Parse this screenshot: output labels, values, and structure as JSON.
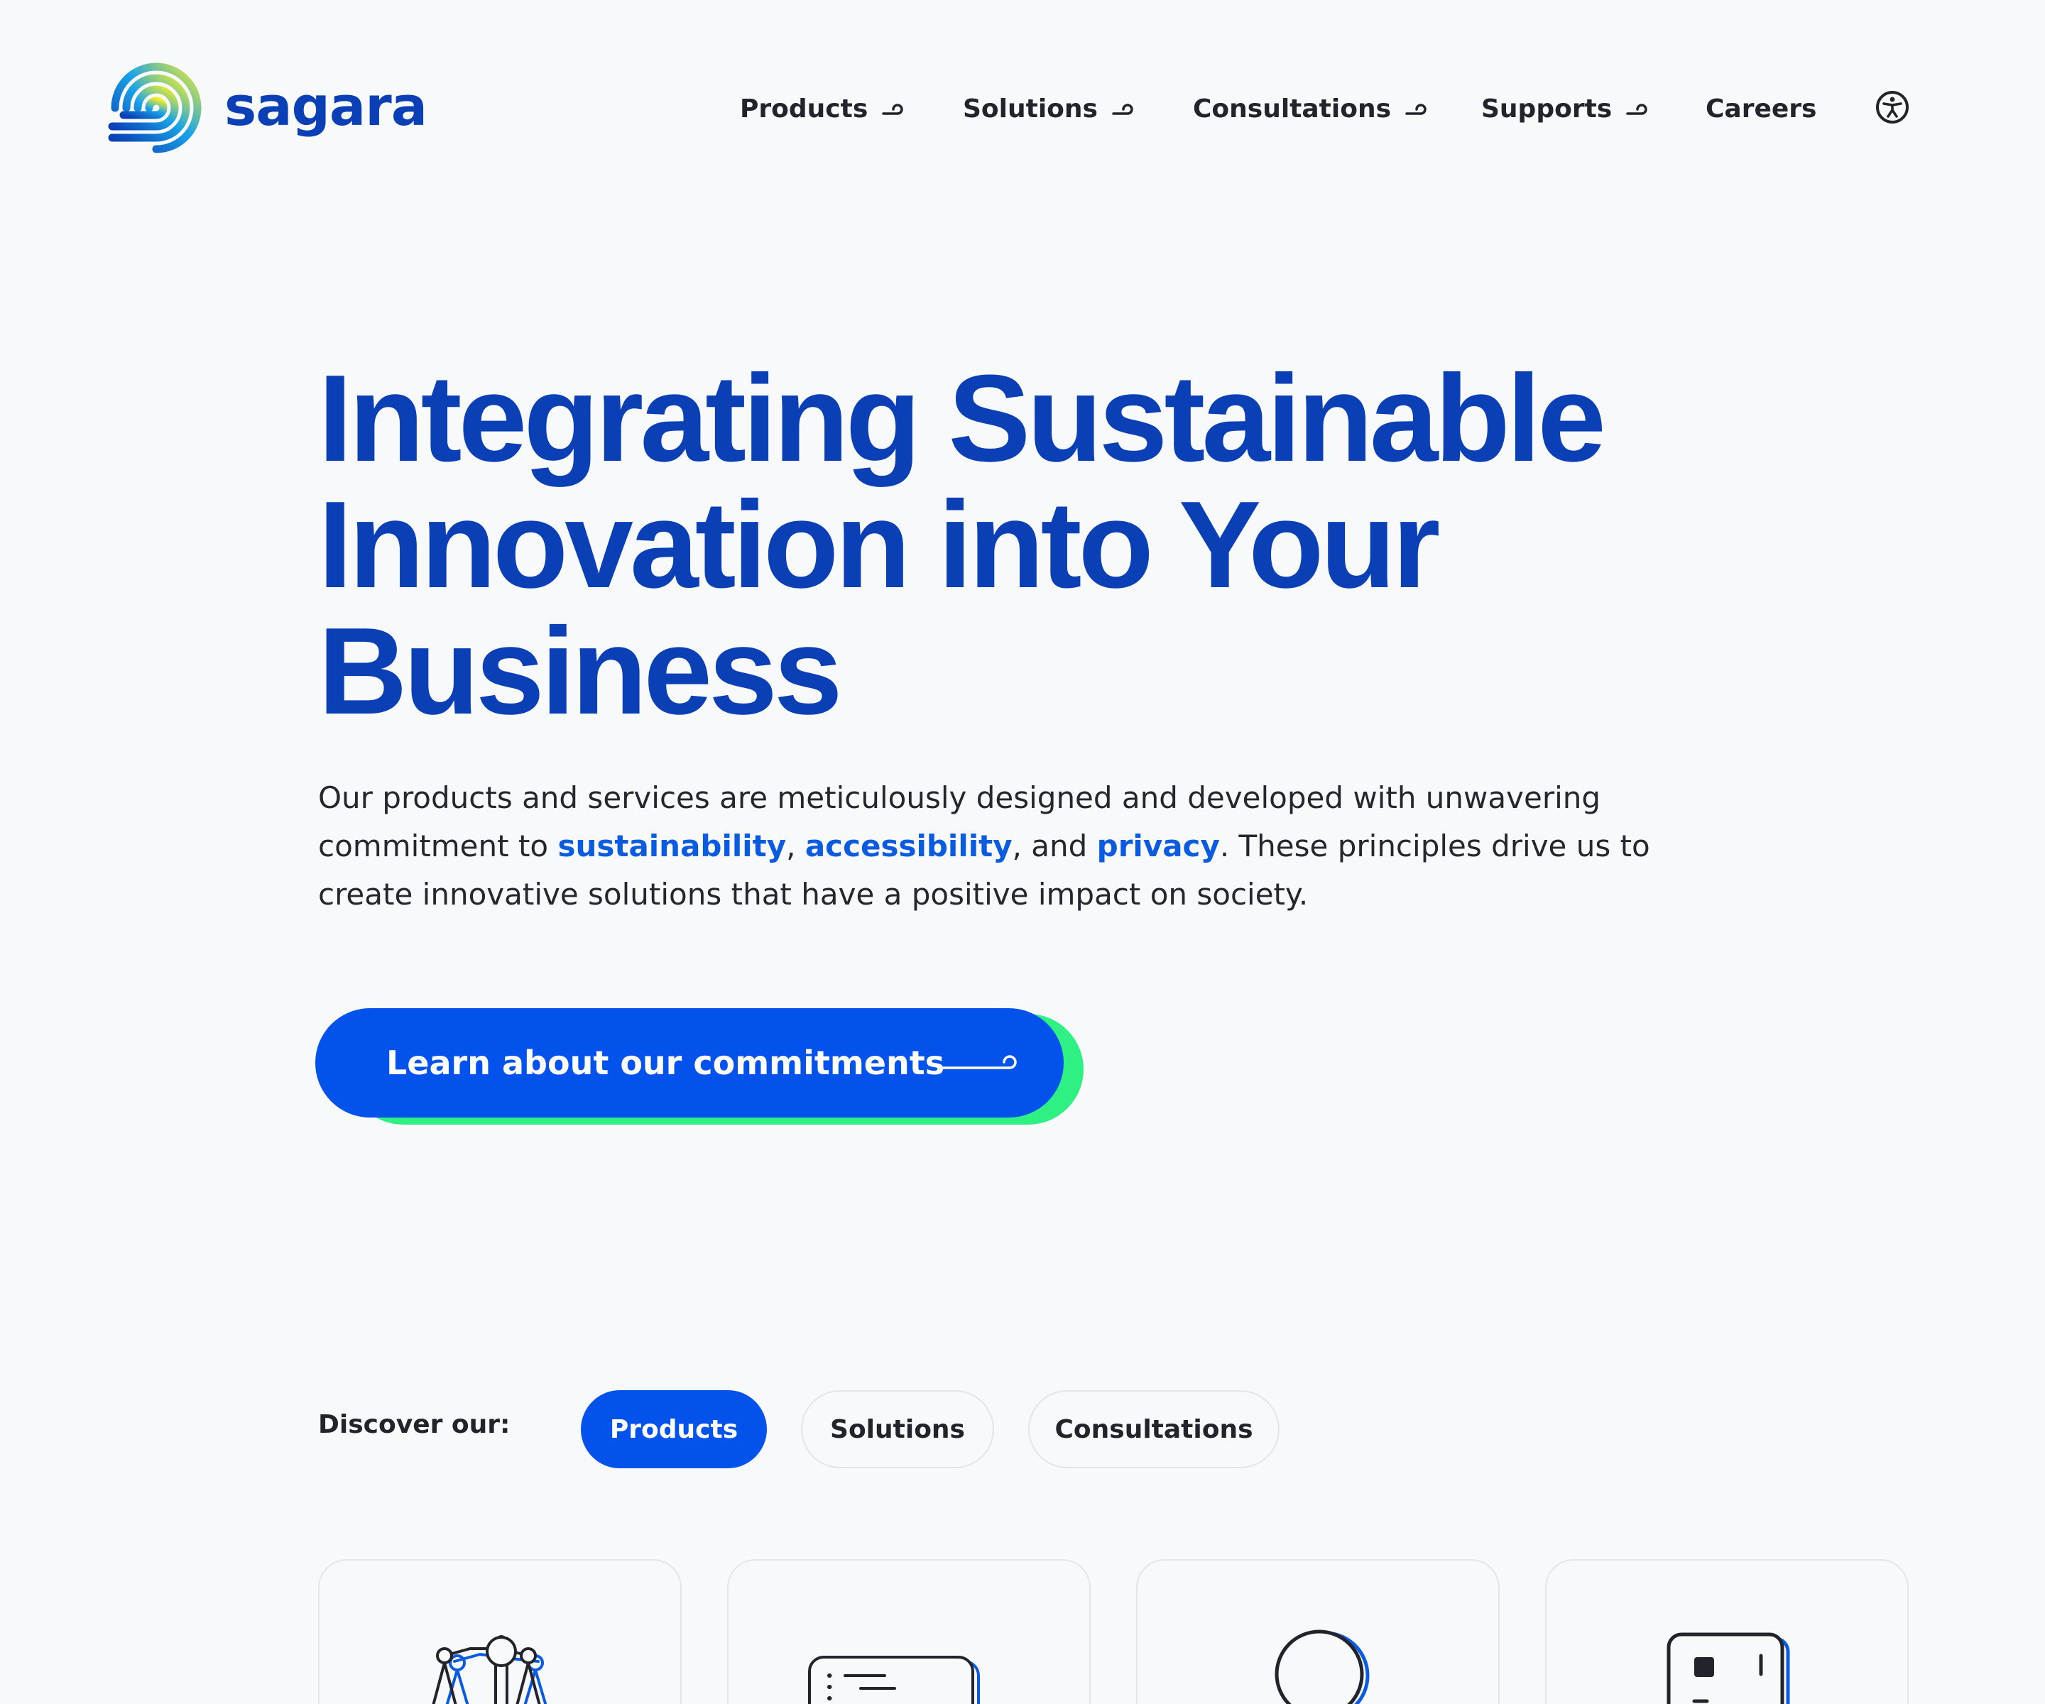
{
  "brand": {
    "name": "sagara"
  },
  "nav": {
    "items": [
      {
        "label": "Products",
        "has_dropdown": true
      },
      {
        "label": "Solutions",
        "has_dropdown": true
      },
      {
        "label": "Consultations",
        "has_dropdown": true
      },
      {
        "label": "Supports",
        "has_dropdown": true
      },
      {
        "label": "Careers",
        "has_dropdown": false
      }
    ],
    "accessibility_icon": "accessibility-icon"
  },
  "hero": {
    "title_lines": [
      "Integrating Sustainable",
      "Innovation into Your",
      "Business"
    ],
    "description": {
      "part1": "Our products and services are meticulously designed and developed with unwavering commitment to ",
      "kw1": "sustainability",
      "sep1": ", ",
      "kw2": "accessibility",
      "sep2": ", and ",
      "kw3": "privacy",
      "part2": ". These principles drive us to create innovative solutions that have a positive impact on society."
    },
    "cta_label": "Learn about our commitments"
  },
  "discover": {
    "label": "Discover our:",
    "tabs": [
      {
        "label": "Products",
        "active": true
      },
      {
        "label": "Solutions",
        "active": false
      },
      {
        "label": "Consultations",
        "active": false
      }
    ]
  },
  "cards": [
    {
      "icon": "scales-icon"
    },
    {
      "icon": "terminal-window-icon"
    },
    {
      "icon": "circle-icon"
    },
    {
      "icon": "device-icon"
    }
  ],
  "colors": {
    "brand_blue": "#0a3fb5",
    "accent_blue": "#0452ec",
    "link_blue": "#0b5be0",
    "accent_green": "#2ff083",
    "background": "#f8f9fb",
    "text": "#23232b"
  }
}
